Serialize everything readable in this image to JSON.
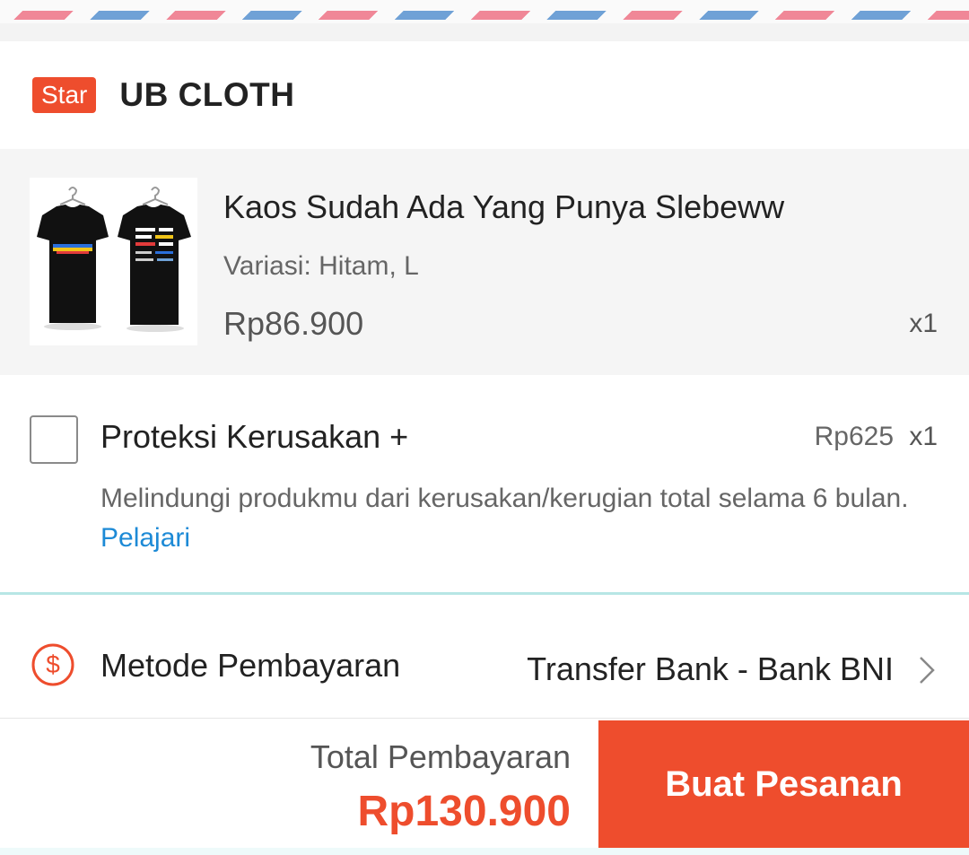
{
  "shop": {
    "badge": "Star",
    "name": "UB CLOTH"
  },
  "product": {
    "title": "Kaos Sudah Ada Yang Punya Slebeww",
    "variant": "Variasi: Hitam, L",
    "price": "Rp86.900",
    "quantity": "x1",
    "image_icon": "tshirt-product-image"
  },
  "protection": {
    "title": "Proteksi Kerusakan +",
    "price": "Rp625",
    "quantity": "x1",
    "description": "Melindungi produkmu dari kerusakan/kerugian total selama 6 bulan. ",
    "link": "Pelajari",
    "checked": false
  },
  "payment": {
    "icon": "dollar-icon",
    "label": "Metode Pembayaran",
    "value": "Transfer Bank - Bank BNI"
  },
  "footer": {
    "total_label": "Total Pembayaran",
    "total_value": "Rp130.900",
    "order_button": "Buat Pesanan"
  },
  "colors": {
    "accent": "#ee4d2d",
    "link": "#1d8ad6",
    "stripe_pink": "#f08797",
    "stripe_blue": "#6fa1d6",
    "divider": "#b7e6e5"
  }
}
